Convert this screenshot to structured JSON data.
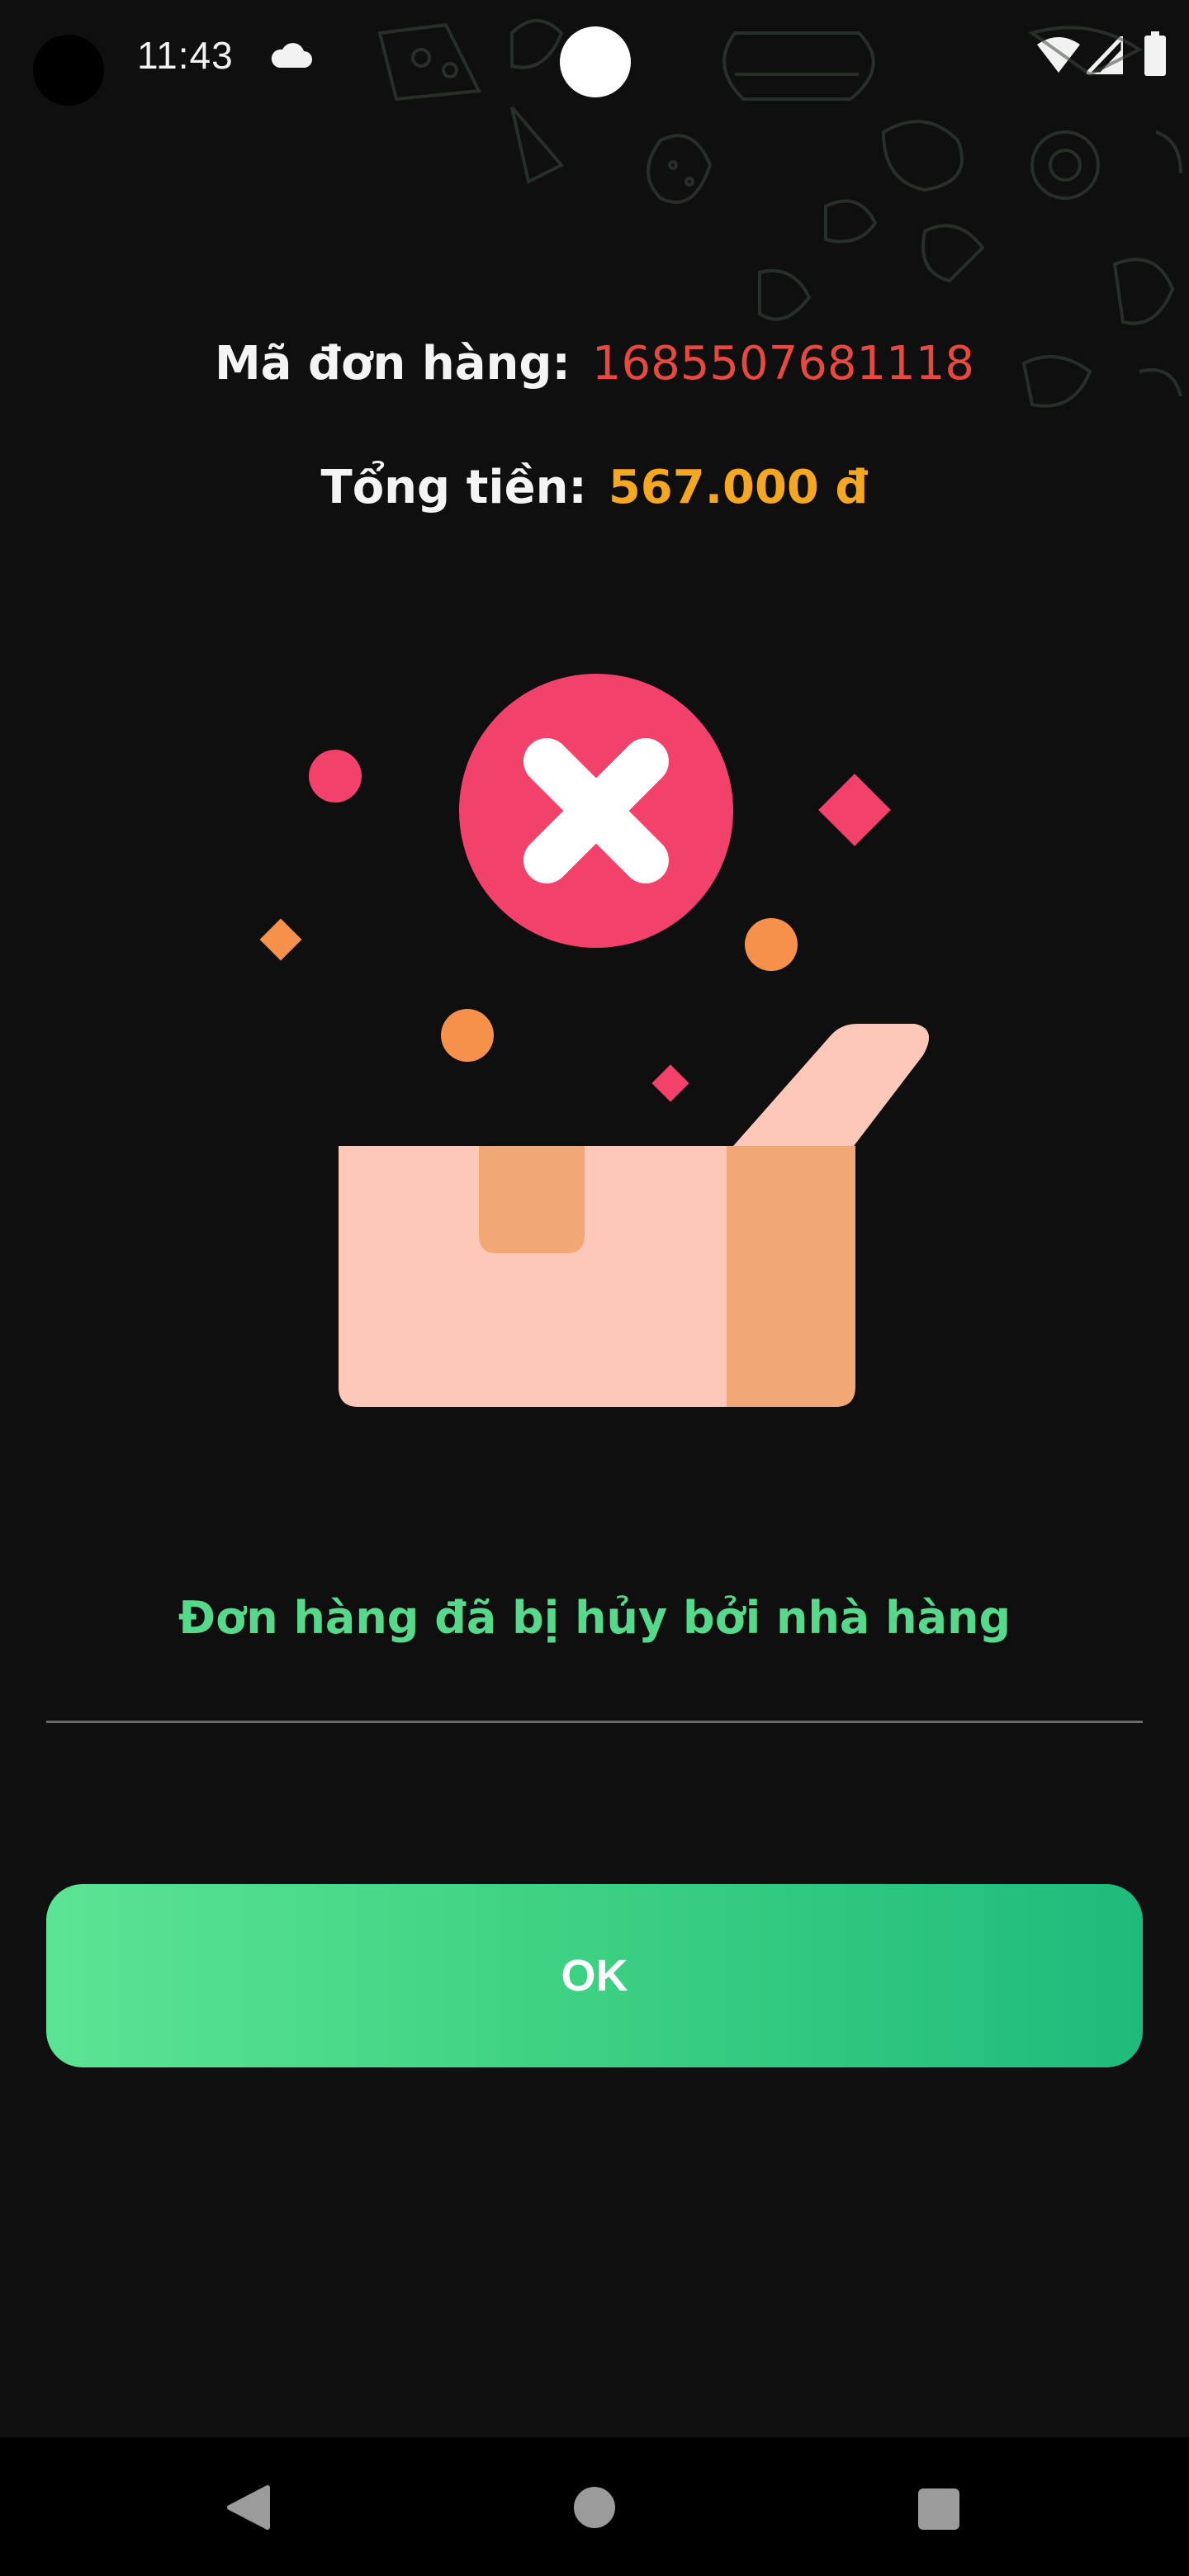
{
  "status_bar": {
    "time": "11:43",
    "icons": [
      "cloud-icon",
      "wifi-icon",
      "signal-icon",
      "battery-icon"
    ]
  },
  "order": {
    "id_label": "Mã đơn hàng:",
    "id_value": "1685507681118",
    "total_label": "Tổng tiền:",
    "total_value": "567.000 đ"
  },
  "illustration": {
    "icon": "cancelled-box-illustration",
    "badge_icon": "close-x-icon"
  },
  "message": "Đơn hàng đã bị hủy bởi nhà hàng",
  "ok_button": {
    "label": "OK"
  },
  "nav_bar": {
    "icons": [
      "back-icon",
      "home-icon",
      "recents-icon"
    ]
  },
  "colors": {
    "background": "#0f0f0f",
    "order_id": "#e8493f",
    "total": "#f5a623",
    "message": "#56d98b",
    "button_start": "#5be494",
    "button_end": "#1fbb7c",
    "badge": "#f2426b",
    "box_light": "#fdc7b9",
    "box_dark": "#f2a874",
    "confetti_orange": "#f5914a",
    "confetti_pink": "#f2426b"
  }
}
